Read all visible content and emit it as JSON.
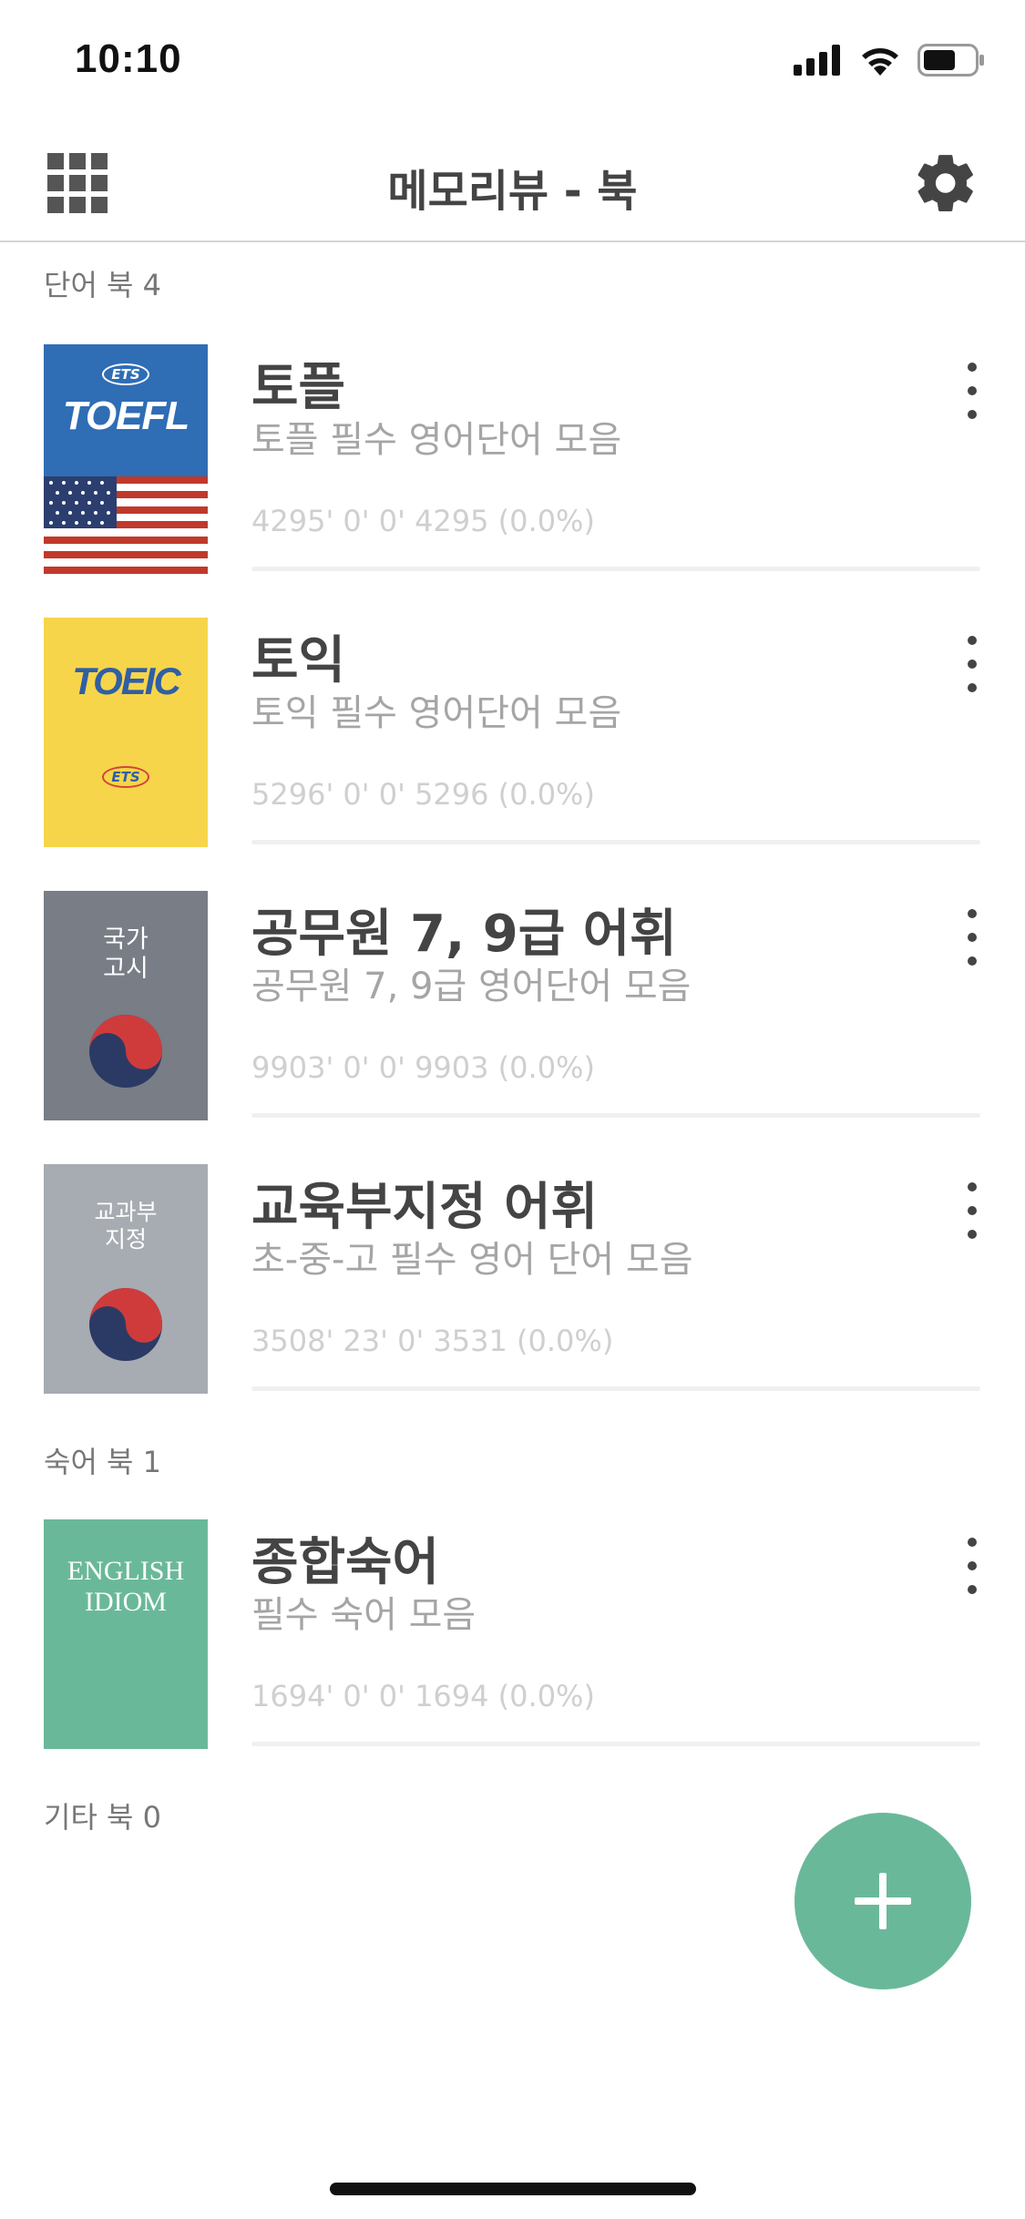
{
  "status_bar": {
    "time": "10:10"
  },
  "nav": {
    "title": "메모리뷰 - 북"
  },
  "sections": {
    "word": {
      "label": "단어 북 4"
    },
    "idiom": {
      "label": "숙어 북 1"
    },
    "other": {
      "label": "기타 북 0"
    }
  },
  "books": [
    {
      "title": "토플",
      "description": "토플 필수 영어단어 모음",
      "stats": "4295' 0' 0' 4295 (0.0%)",
      "cover": {
        "brand": "ETS",
        "label": "TOEFL",
        "color": "#2f6db5"
      }
    },
    {
      "title": "토익",
      "description": "토익 필수 영어단어 모음",
      "stats": "5296' 0' 0' 5296 (0.0%)",
      "cover": {
        "brand": "ETS",
        "label": "TOEIC",
        "color": "#f7d54a"
      }
    },
    {
      "title": "공무원 7, 9급 어휘",
      "description": "공무원 7, 9급 영어단어 모음",
      "stats": "9903' 0' 0' 9903 (0.0%)",
      "cover": {
        "line1": "국가",
        "line2": "고시",
        "color": "#787d86"
      }
    },
    {
      "title": "교육부지정 어휘",
      "description": "초-중-고 필수 영어 단어 모음",
      "stats": "3508' 23' 0' 3531 (0.0%)",
      "cover": {
        "line1": "교과부",
        "line2": "지정",
        "color": "#a7abb2"
      }
    },
    {
      "title": "종합숙어",
      "description": "필수 숙어 모음",
      "stats": "1694' 0' 0' 1694 (0.0%)",
      "cover": {
        "line1": "ENGLISH",
        "line2": "IDIOM",
        "color": "#6ab89a"
      }
    }
  ],
  "colors": {
    "accent": "#6ab89a",
    "title": "#444444",
    "subtitle": "#a5a5a5",
    "stats": "#cfcfcf"
  },
  "icons": [
    "grid-menu-icon",
    "gear-icon",
    "more-vertical-icon",
    "plus-icon",
    "signal-icon",
    "wifi-icon",
    "battery-icon"
  ]
}
